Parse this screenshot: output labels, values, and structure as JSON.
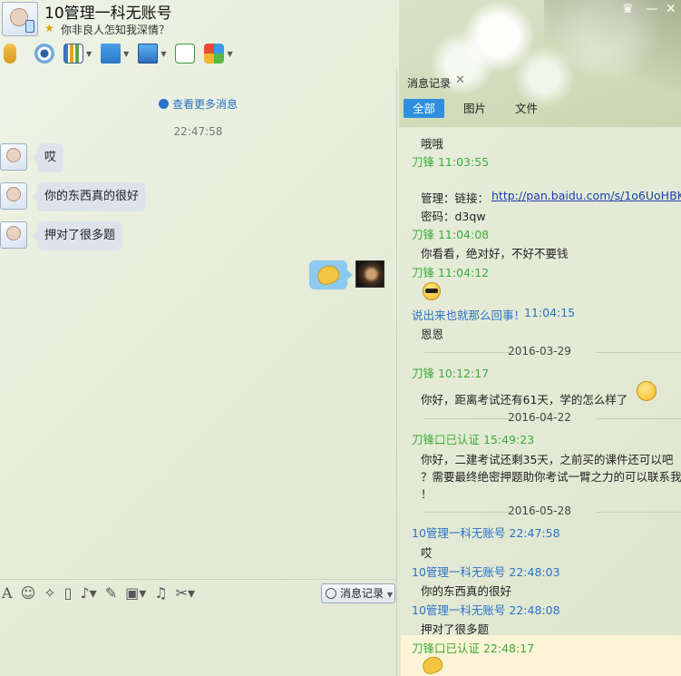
{
  "window": {
    "title": "10管理一科无账号",
    "signature": "你非良人怎知我深情？",
    "controls": {
      "minimize": "—",
      "maximize": "□",
      "close": "✕"
    }
  },
  "toolbar": {
    "icons": [
      "microphone-icon",
      "video-camera-icon",
      "whiteboard-icon",
      "transfer-file-icon",
      "remote-desktop-icon",
      "new-chat-icon",
      "apps-grid-icon"
    ]
  },
  "chat": {
    "more_messages": "查看更多消息",
    "timestamp": "22:47:58",
    "messages": [
      {
        "text": "哎"
      },
      {
        "text": "你的东西真的很好"
      },
      {
        "text": "押对了很多题"
      }
    ]
  },
  "input_toolbar": {
    "history_button": "消息记录"
  },
  "history_panel": {
    "tab_label": "消息记录",
    "filters": [
      "全部",
      "图片",
      "文件"
    ],
    "lines": [
      {
        "type": "content",
        "text": "哦哦"
      },
      {
        "type": "sender",
        "text": "刀锋 11:03:55"
      },
      {
        "type": "content",
        "text": "管理：链接："
      },
      {
        "type": "link",
        "text": "http://pan.baidu.com/s/1o6UoHBK"
      },
      {
        "type": "content",
        "text": "密码：d3qw"
      },
      {
        "type": "sender",
        "text": "刀锋 11:04:08"
      },
      {
        "type": "content",
        "text": "你看看，绝对好，不好不要钱"
      },
      {
        "type": "sender",
        "text": "刀锋 11:04:12"
      },
      {
        "type": "sender",
        "text": "说出来也就那么回事！"
      },
      {
        "type": "sender",
        "text": "11:04:15"
      },
      {
        "type": "content",
        "text": "恩恩"
      },
      {
        "type": "date",
        "text": "2016-03-29"
      },
      {
        "type": "sender",
        "text": "刀锋 10:12:17"
      },
      {
        "type": "content",
        "text": "你好，距离考试还有61天，学的怎么样了"
      },
      {
        "type": "date",
        "text": "2016-04-22"
      },
      {
        "type": "sender",
        "text": "刀锋口已认证 15:49:23"
      },
      {
        "type": "content",
        "text": "你好，二建考试还剩35天，之前买的课件还可以吧"
      },
      {
        "type": "content",
        "text": "？需要最终绝密押题助你考试一臂之力的可以联系我"
      },
      {
        "type": "content",
        "text": "！"
      },
      {
        "type": "date",
        "text": "2016-05-28"
      },
      {
        "type": "sender",
        "text": "10管理一科无账号 22:47:58"
      },
      {
        "type": "content",
        "text": "哎"
      },
      {
        "type": "sender",
        "text": "10管理一科无账号 22:48:03"
      },
      {
        "type": "content",
        "text": "你的东西真的很好"
      },
      {
        "type": "sender",
        "text": "10管理一科无账号 22:48:08"
      },
      {
        "type": "content",
        "text": "押对了很多题"
      },
      {
        "type": "sender",
        "text": "刀锋口已认证 22:48:17"
      }
    ]
  },
  "colors": {
    "accent_blue": "#2e8fe0",
    "sender_green": "#3bab3b",
    "sender_blue": "#2a72c8",
    "highlight": "#fdf3d6"
  }
}
